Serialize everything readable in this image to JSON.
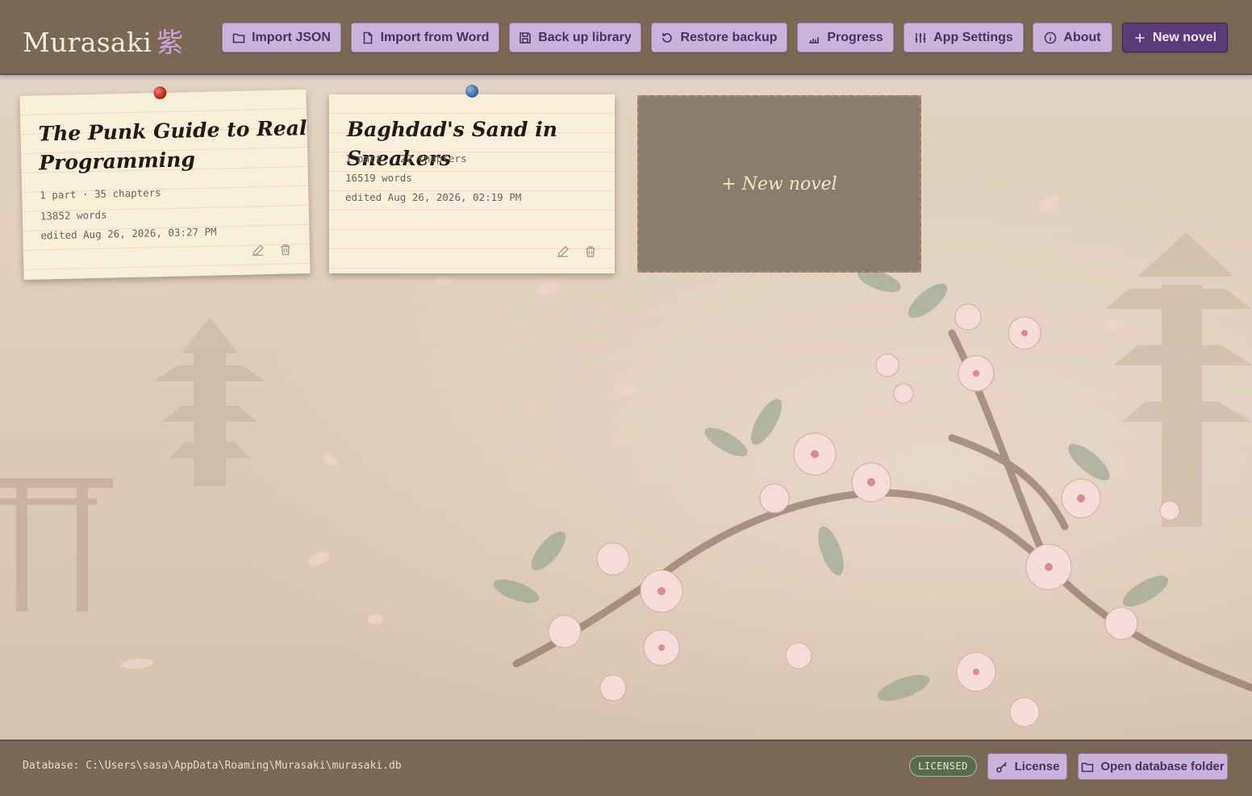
{
  "app": {
    "name": "Murasaki",
    "kanji": "紫"
  },
  "toolbar": {
    "import_json": "Import JSON",
    "import_word": "Import from Word",
    "backup": "Back up library",
    "restore": "Restore backup",
    "progress": "Progress",
    "settings": "App Settings",
    "about": "About",
    "new_novel": "New novel"
  },
  "novels": [
    {
      "title_line1": "The Punk Guide to Real",
      "title_line2": "Programming",
      "structure": "1 part · 35 chapters",
      "words": "13852 words",
      "edited": "edited Aug 26, 2026, 03:27 PM",
      "pin_color": "#c0392b"
    },
    {
      "title_line1": "Baghdad's Sand in Sneakers",
      "structure": "1 part · 22 chapters",
      "words": "16519 words",
      "edited": "edited Aug 26, 2026, 02:19 PM",
      "pin_color": "#3f6aa0"
    }
  ],
  "new_card": {
    "label": "+ New novel"
  },
  "footer": {
    "database_path": "Database: C:\\Users\\sasa\\AppData\\Roaming\\Murasaki\\murasaki.db",
    "license_badge": "LICENSED",
    "license_button": "License",
    "open_folder_button": "Open database folder"
  },
  "icons": {
    "import_json": "folder-icon",
    "import_word": "document-icon",
    "backup": "save-icon",
    "restore": "restore-icon",
    "progress": "bar-chart-icon",
    "settings": "sliders-icon",
    "about": "info-icon",
    "new_novel": "plus-icon",
    "edit": "pencil-icon",
    "delete": "trash-icon",
    "license": "key-icon",
    "open_folder": "folder-icon"
  },
  "colors": {
    "accent": "#5a3a78",
    "button_bg": "#c9b3da",
    "header_bg": "#7a6754",
    "card_bg": "#f8efdb",
    "licensed": "#5b6a4c"
  }
}
